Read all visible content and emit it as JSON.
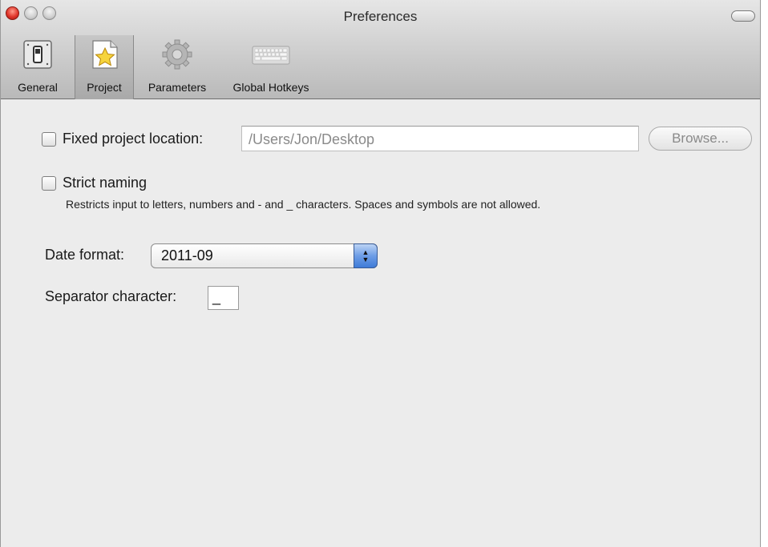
{
  "window": {
    "title": "Preferences"
  },
  "toolbar": {
    "items": [
      {
        "label": "General",
        "icon": "switch-icon"
      },
      {
        "label": "Project",
        "icon": "star-icon",
        "selected": true
      },
      {
        "label": "Parameters",
        "icon": "gear-icon"
      },
      {
        "label": "Global Hotkeys",
        "icon": "keyboard-icon"
      }
    ]
  },
  "project": {
    "fixed_location_label": "Fixed project location:",
    "fixed_location_value": "/Users/Jon/Desktop",
    "browse_label": "Browse...",
    "strict_naming_label": "Strict naming",
    "strict_naming_help": "Restricts input to letters, numbers and - and _ characters. Spaces and symbols are not allowed.",
    "date_format_label": "Date format:",
    "date_format_value": "2011-09",
    "separator_label": "Separator character:",
    "separator_value": "_"
  },
  "colors": {
    "close_light": "#e0362b",
    "stepper_blue": "#3f7bd8"
  }
}
